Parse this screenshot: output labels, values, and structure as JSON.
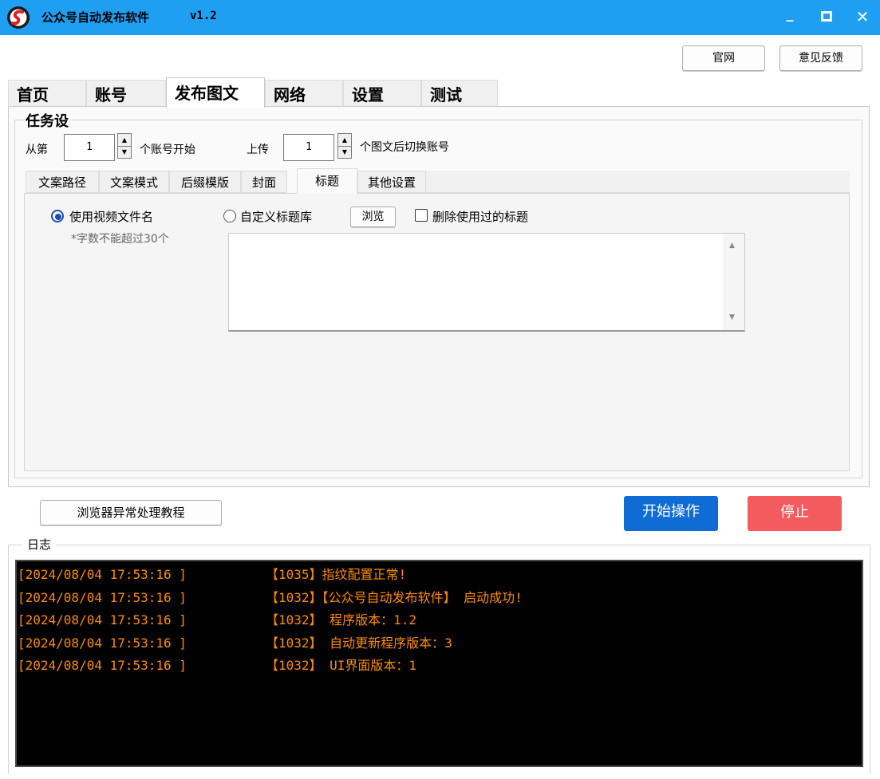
{
  "window": {
    "title": "公众号自动发布软件",
    "version": "v1.2",
    "minimize": "_",
    "maximize": "□",
    "close": "✕"
  },
  "header_buttons": {
    "website": "官网",
    "feedback": "意见反馈"
  },
  "main_tabs": [
    "首页",
    "账号",
    "发布图文",
    "网络",
    "设置",
    "测试"
  ],
  "main_tab_active": "发布图文",
  "task_settings": {
    "legend": "任务设",
    "from_label": "从第",
    "start_account": "1",
    "start_suffix": "个账号开始",
    "upload_label": "上传",
    "switch_count": "1",
    "switch_suffix": "个图文后切换账号"
  },
  "sub_tabs": [
    "文案路径",
    "文案模式",
    "后缀模版",
    "封面",
    "标题",
    "其他设置"
  ],
  "sub_tab_active": "标题",
  "title_options": {
    "use_filename": "使用视频文件名",
    "limit_hint": "*字数不能超过30个",
    "custom_library": "自定义标题库",
    "browse": "浏览",
    "delete_used": "删除使用过的标题",
    "textarea_value": ""
  },
  "actions": {
    "browser_tutorial": "浏览器异常处理教程",
    "start": "开始操作",
    "stop": "停止"
  },
  "log": {
    "legend": "日志",
    "lines": [
      {
        "time": "[2024/08/04 17:53:16 ]",
        "msg": "【1035】指纹配置正常!"
      },
      {
        "time": "[2024/08/04 17:53:16 ]",
        "msg": "【1032】【公众号自动发布软件】 启动成功!"
      },
      {
        "time": "[2024/08/04 17:53:16 ]",
        "msg": "【1032】 程序版本：1.2"
      },
      {
        "time": "[2024/08/04 17:53:16 ]",
        "msg": "【1032】 自动更新程序版本：3"
      },
      {
        "time": "[2024/08/04 17:53:16 ]",
        "msg": "【1032】 UI界面版本：1"
      }
    ]
  },
  "colors": {
    "titlebar": "#1e9ff2",
    "start_button": "#0f6cd4",
    "stop_button": "#f45b5e",
    "log_text": "#ff8c00",
    "log_bg": "#000000"
  }
}
